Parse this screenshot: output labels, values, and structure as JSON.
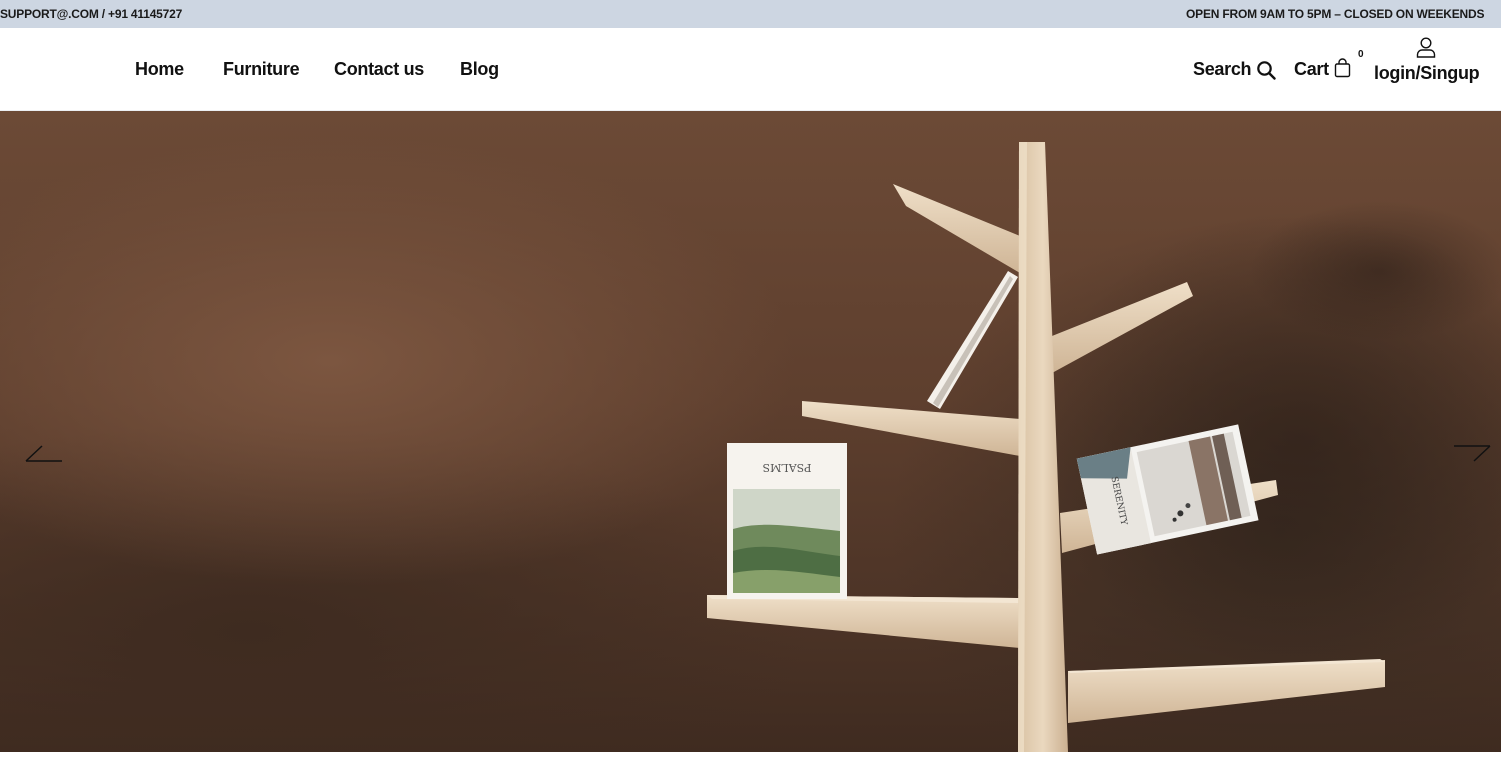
{
  "topbar": {
    "contact": "SUPPORT@.COM / +91 41145727",
    "hours": "OPEN FROM 9AM TO 5PM – CLOSED ON WEEKENDS"
  },
  "nav": {
    "items": [
      {
        "label": "Home"
      },
      {
        "label": "Furniture"
      },
      {
        "label": "Contact us"
      },
      {
        "label": "Blog"
      }
    ]
  },
  "utility": {
    "search_label": "Search",
    "search_icon": "search-icon",
    "cart_label": "Cart",
    "cart_icon": "shopping-bag-icon",
    "cart_count": "0",
    "user_icon": "user-icon",
    "login_label": "login/Singup"
  },
  "hero": {
    "prev_icon": "arrow-left-icon",
    "next_icon": "arrow-right-icon",
    "book_left_title": "PSALMS",
    "book_right_title": "SERENITY",
    "colors": {
      "wall": "#5e3f2e",
      "wood": "#e3cfb5"
    }
  }
}
